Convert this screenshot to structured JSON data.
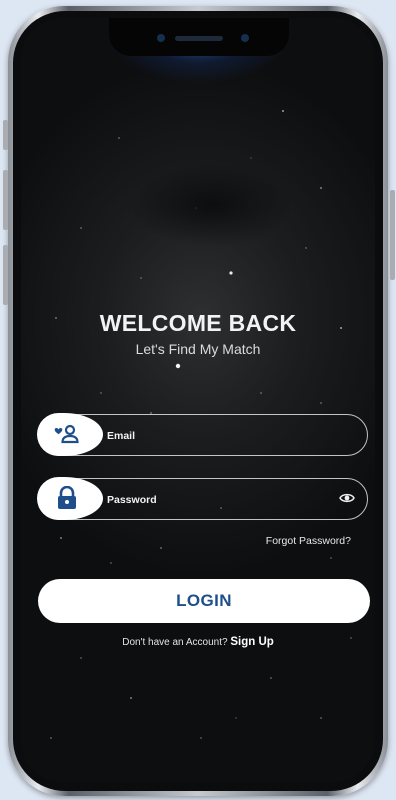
{
  "welcome": {
    "title": "WELCOME BACK",
    "subtitle": "Let's Find My Match"
  },
  "form": {
    "email_placeholder": "Email",
    "password_placeholder": "Password",
    "forgot_label": "Forgot Password?",
    "login_label": "LOGIN"
  },
  "signup": {
    "prompt": "Don't have an Account?",
    "link": "Sign Up"
  },
  "icons": {
    "email": "user-heart-icon",
    "password": "lock-icon",
    "toggle": "eye-icon"
  },
  "colors": {
    "accent": "#1f4f8a",
    "background": "#1c1d1f",
    "field_border": "#ffffff"
  }
}
